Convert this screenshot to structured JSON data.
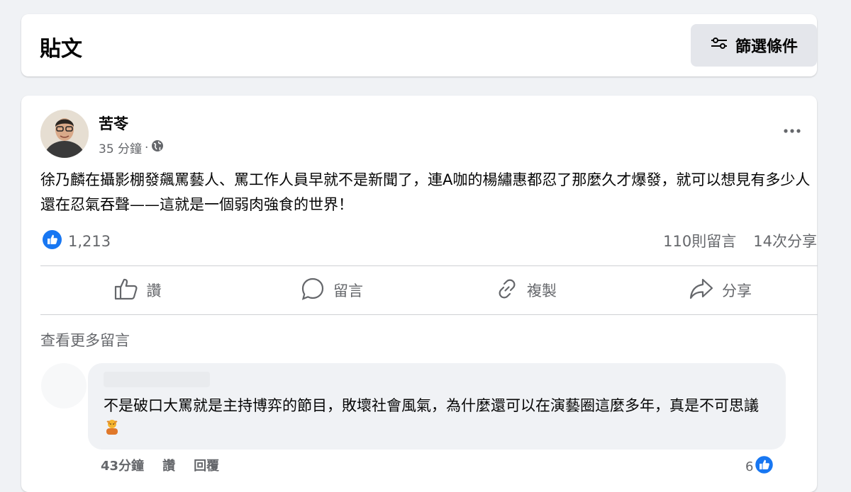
{
  "header": {
    "title": "貼文",
    "filter_label": "篩選條件"
  },
  "post": {
    "author": "苦苓",
    "time": "35 分鐘",
    "separator": "·",
    "text": "徐乃麟在攝影棚發飆罵藝人、罵工作人員早就不是新聞了，連A咖的楊繡惠都忍了那麼久才爆發，就可以想見有多少人還在忍氣吞聲——這就是一個弱肉強食的世界！",
    "likes": "1,213",
    "comments_count": "110則留言",
    "shares_count": "14次分享"
  },
  "actions": {
    "like": "讚",
    "comment": "留言",
    "copy": "複製",
    "share": "分享"
  },
  "see_more": "查看更多留言",
  "comment": {
    "text": "不是破口大罵就是主持博弈的節目，敗壞社會風氣，為什麼還可以在演藝圈這麼多年，真是不可思議",
    "time": "43分鐘",
    "like": "讚",
    "reply": "回覆",
    "reactions": "6"
  },
  "colors": {
    "like_blue": "#1877f2",
    "secondary_text": "#65676b",
    "page_bg": "#f0f2f5"
  }
}
